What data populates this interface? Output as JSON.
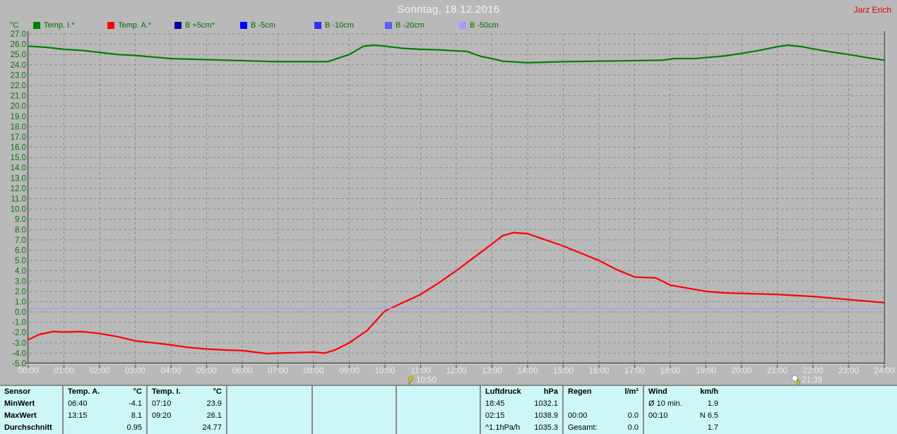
{
  "header": {
    "title": "Sonntag, 18.12.2016",
    "user": "Jarz Erich"
  },
  "legend": {
    "unit": "°C",
    "items": [
      {
        "label": "Temp. I.*",
        "color": "#008000"
      },
      {
        "label": "Temp. A.*",
        "color": "#0000a0"
      },
      {
        "label": "B +5cm*",
        "color": "#0000a0"
      },
      {
        "label": "B -5cm",
        "color": "#0000ff"
      },
      {
        "label": "B -10cm",
        "color": "#2e2eff"
      },
      {
        "label": "B -20cm",
        "color": "#5c5cff"
      },
      {
        "label": "B -50cm",
        "color": "#9e9eff"
      }
    ],
    "swatch_colors": [
      "#008000",
      "#ff0000",
      "#0000a0",
      "#0000ff",
      "#2e2eff",
      "#5c5cff",
      "#9e9eff"
    ]
  },
  "chart_data": {
    "type": "line",
    "title": "Sonntag, 18.12.2016",
    "ylabel": "°C",
    "ylim": [
      -5,
      27
    ],
    "ytick_step": 1,
    "ytick_format": "one-decimal",
    "xlim": [
      0,
      24
    ],
    "xtick_labels": [
      "00:00",
      "01:00",
      "02:00",
      "03:00",
      "04:00",
      "05:00",
      "06:00",
      "07:00",
      "08:00",
      "09:00",
      "10:00",
      "11:00",
      "12:00",
      "13:00",
      "14:00",
      "15:00",
      "16:00",
      "17:00",
      "18:00",
      "19:00",
      "20:00",
      "21:00",
      "22:00",
      "23:00",
      "24:00"
    ],
    "grid": true,
    "legend_position": "top",
    "series": [
      {
        "name": "Temp. I.*",
        "color": "#008000",
        "x": [
          0,
          0.5,
          1,
          1.5,
          2,
          2.5,
          3,
          3.5,
          4,
          4.5,
          5,
          5.5,
          6,
          6.5,
          7,
          7.5,
          8,
          8.4,
          9,
          9.4,
          9.7,
          10,
          10.5,
          11,
          11.5,
          12,
          12.3,
          12.7,
          13,
          13.3,
          14,
          14.5,
          15,
          16,
          17,
          17.8,
          18.1,
          18.7,
          19,
          19.5,
          20,
          20.5,
          21,
          21.3,
          21.7,
          22,
          22.5,
          23,
          23.5,
          24
        ],
        "y": [
          25.8,
          25.7,
          25.5,
          25.4,
          25.2,
          25.0,
          24.9,
          24.75,
          24.6,
          24.55,
          24.5,
          24.45,
          24.4,
          24.35,
          24.3,
          24.3,
          24.3,
          24.3,
          25.0,
          25.8,
          25.9,
          25.8,
          25.6,
          25.5,
          25.45,
          25.35,
          25.3,
          24.8,
          24.6,
          24.35,
          24.2,
          24.25,
          24.3,
          24.35,
          24.4,
          24.45,
          24.6,
          24.6,
          24.7,
          24.85,
          25.1,
          25.4,
          25.75,
          25.9,
          25.75,
          25.55,
          25.25,
          25.0,
          24.7,
          24.45
        ]
      },
      {
        "name": "Temp. A.*",
        "color": "#ff0000",
        "x": [
          0,
          0.3,
          0.7,
          1,
          1.5,
          2,
          2.5,
          3,
          3.5,
          4,
          4.5,
          5,
          5.5,
          6,
          6.7,
          7,
          7.5,
          8,
          8.3,
          8.6,
          9,
          9.5,
          10,
          10.5,
          11,
          11.5,
          12,
          12.5,
          13,
          13.3,
          13.6,
          14,
          14.5,
          15,
          15.5,
          16,
          16.5,
          17,
          17.6,
          18,
          18.5,
          19,
          19.5,
          20,
          21,
          22,
          22.5,
          23,
          23.5,
          24
        ],
        "y": [
          -2.7,
          -2.2,
          -1.9,
          -1.95,
          -1.9,
          -2.1,
          -2.4,
          -2.8,
          -3.0,
          -3.2,
          -3.45,
          -3.6,
          -3.7,
          -3.75,
          -4.05,
          -4.0,
          -3.95,
          -3.9,
          -4.0,
          -3.7,
          -3.0,
          -1.8,
          0.1,
          0.9,
          1.7,
          2.8,
          4.0,
          5.3,
          6.6,
          7.4,
          7.7,
          7.6,
          7.0,
          6.4,
          5.7,
          5.0,
          4.1,
          3.4,
          3.3,
          2.6,
          2.3,
          2.0,
          1.85,
          1.8,
          1.7,
          1.5,
          1.35,
          1.2,
          1.05,
          0.9
        ]
      },
      {
        "name": "B -50cm",
        "color": "#9e9eff",
        "x": [
          0,
          24
        ],
        "y": [
          0.35,
          0.35
        ]
      }
    ]
  },
  "markers": [
    {
      "time": "10:50",
      "hour": 10.833,
      "icon": "sun"
    },
    {
      "time": "21:39",
      "hour": 21.65,
      "icon": "moon"
    }
  ],
  "table": {
    "row_labels": [
      "Sensor",
      "MinWert",
      "MaxWert",
      "Durchschnitt"
    ],
    "columns": [
      {
        "header": "Temp. A.",
        "unit": "°C",
        "rows": [
          [
            "06:40",
            "-4.1"
          ],
          [
            "13:15",
            "8.1"
          ],
          [
            "",
            "0.95"
          ]
        ]
      },
      {
        "header": "Temp. I.",
        "unit": "°C",
        "rows": [
          [
            "07:10",
            "23.9"
          ],
          [
            "09:20",
            "26.1"
          ],
          [
            "",
            "24.77"
          ]
        ]
      },
      {
        "header": "",
        "unit": "",
        "rows": [
          [
            "",
            ""
          ],
          [
            "",
            ""
          ],
          [
            "",
            ""
          ]
        ]
      },
      {
        "header": "",
        "unit": "",
        "rows": [
          [
            "",
            ""
          ],
          [
            "",
            ""
          ],
          [
            "",
            ""
          ]
        ]
      },
      {
        "header": "",
        "unit": "",
        "rows": [
          [
            "",
            ""
          ],
          [
            "",
            ""
          ],
          [
            "",
            ""
          ]
        ]
      },
      {
        "header": "Luftdruck",
        "unit": "hPa",
        "rows": [
          [
            "18:45",
            "1032.1"
          ],
          [
            "02:15",
            "1038.9"
          ],
          [
            "^1.1hPa/h",
            "1035.3"
          ]
        ]
      },
      {
        "header": "Regen",
        "unit": "l/m²",
        "rows": [
          [
            "",
            ""
          ],
          [
            "00:00",
            "0.0"
          ],
          [
            "Gesamt:",
            "0.0"
          ]
        ]
      },
      {
        "header": "Wind",
        "unit": "km/h",
        "rows": [
          [
            "Ø 10 min.",
            "1.9"
          ],
          [
            "00:10",
            "N 6.5"
          ],
          [
            "",
            "1.7"
          ]
        ]
      }
    ]
  }
}
